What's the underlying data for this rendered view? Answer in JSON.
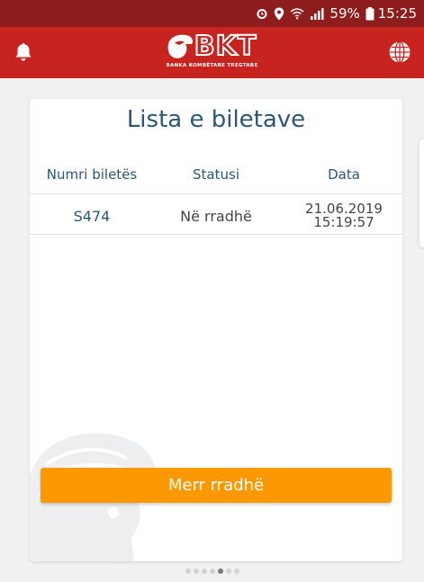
{
  "status_bar": {
    "battery": "59%",
    "time": "15:25",
    "icons": [
      "alarm-icon",
      "location-icon",
      "wifi-icon",
      "signal-icon",
      "battery-icon"
    ]
  },
  "app_bar": {
    "logo_letters": "BKT",
    "logo_subtitle": "BANKA KOMBËTARE TREGTARE",
    "left_icon": "bell-icon",
    "right_icon": "globe-icon",
    "colors": {
      "status_bar": "#8e1d1d",
      "app_bar": "#c8241f"
    }
  },
  "card": {
    "title": "Lista e biletave",
    "headers": {
      "number": "Numri biletës",
      "status": "Statusi",
      "date": "Data"
    },
    "rows": [
      {
        "number": "S474",
        "status": "Në rradhë",
        "date": "21.06.2019",
        "time": "15:19:57"
      }
    ],
    "button_label": "Merr rradhë",
    "colors": {
      "title": "#2a5773",
      "button": "#fd9800"
    }
  },
  "pager": {
    "count": 7,
    "active": 5
  }
}
